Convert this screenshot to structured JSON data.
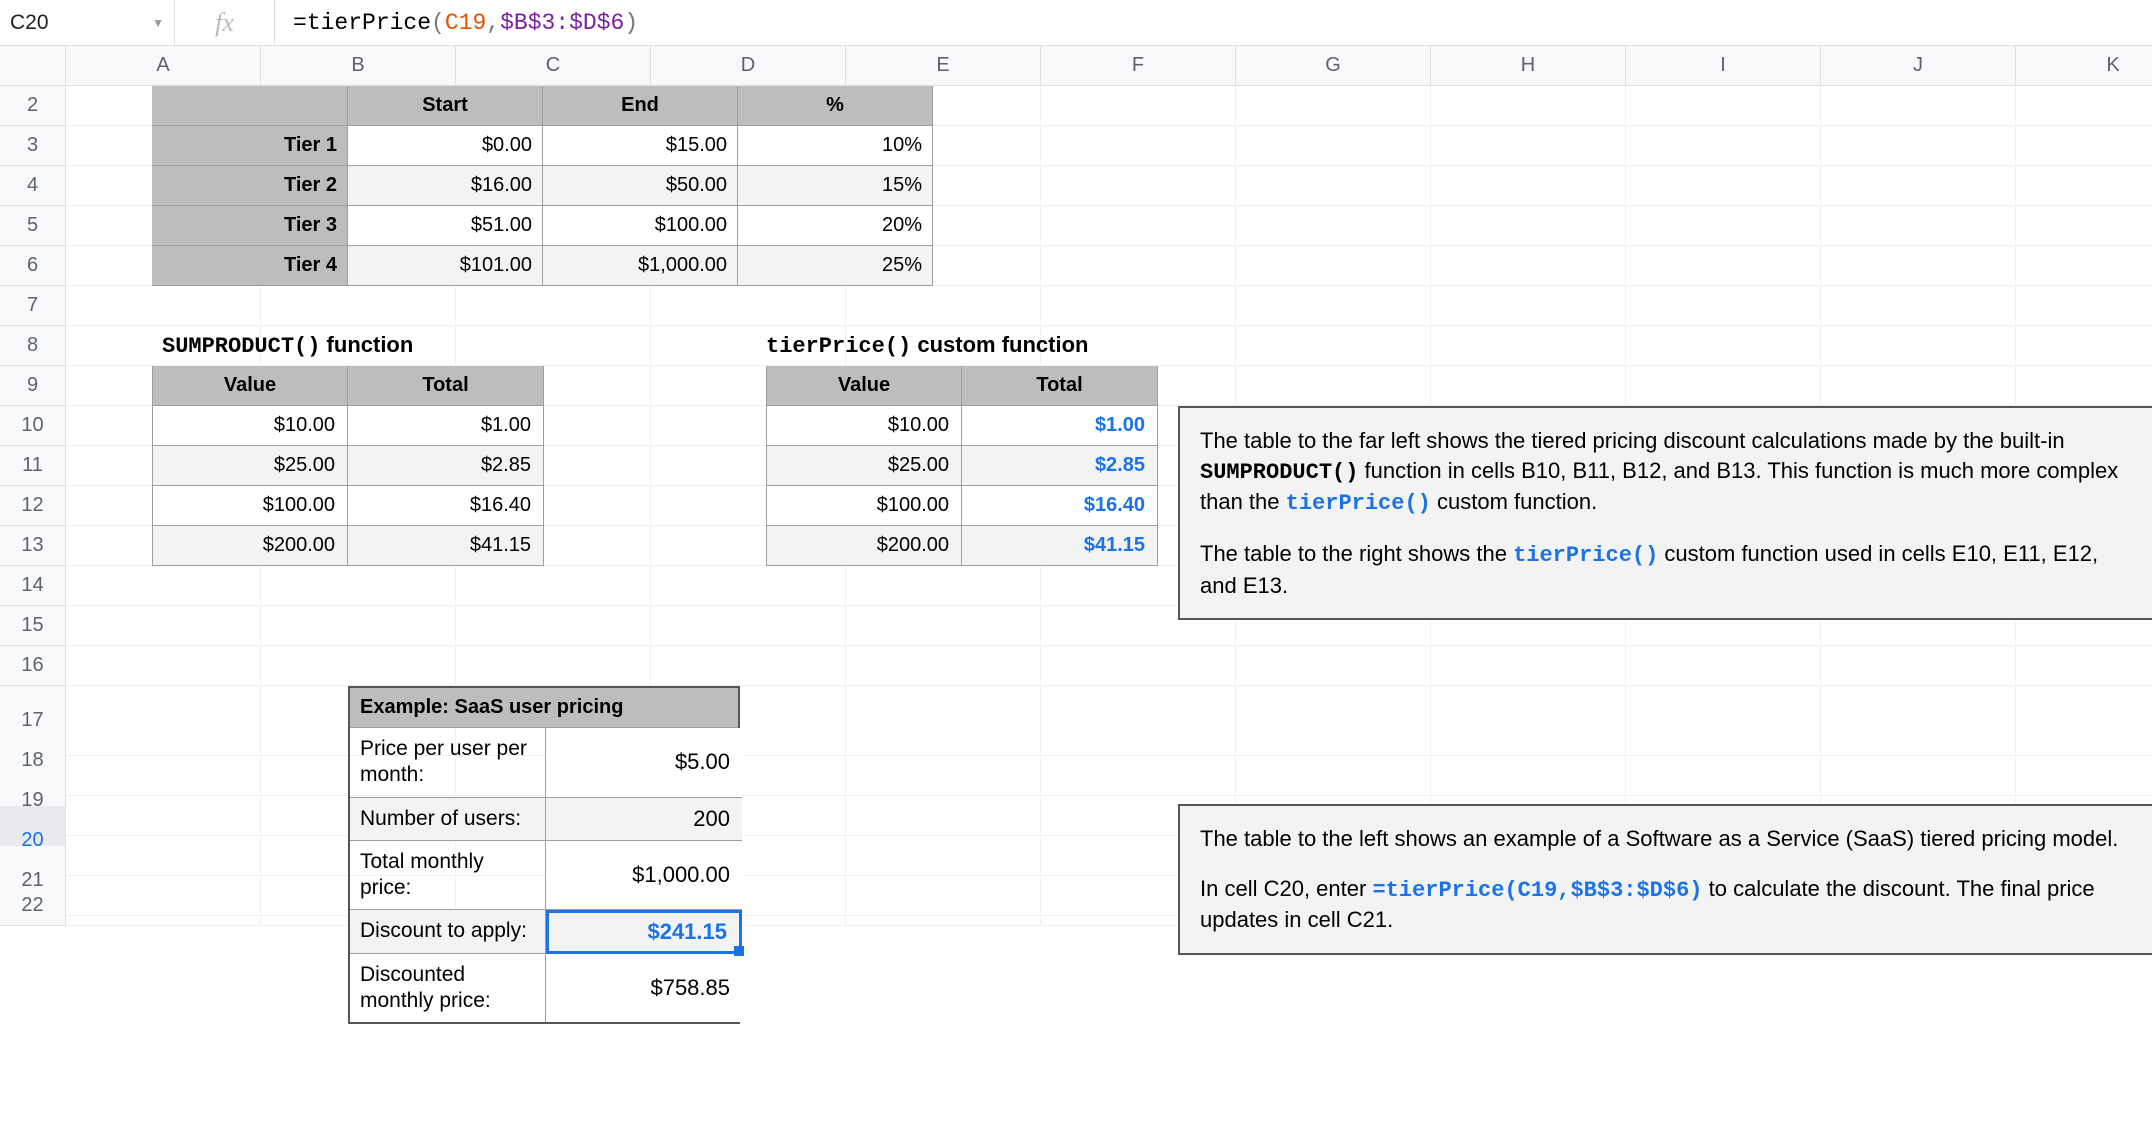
{
  "formula_bar": {
    "cell_ref": "C20",
    "formula_eq": "=",
    "formula_fn": "tierPrice",
    "formula_lp": "(",
    "formula_arg1": "C19",
    "formula_comma": ",",
    "formula_arg2": "$B$3:$D$6",
    "formula_rp": ")"
  },
  "columns": [
    "A",
    "B",
    "C",
    "D",
    "E",
    "F",
    "G",
    "H",
    "I",
    "J",
    "K"
  ],
  "rows": [
    "2",
    "3",
    "4",
    "5",
    "6",
    "7",
    "8",
    "9",
    "10",
    "11",
    "12",
    "13",
    "14",
    "15",
    "16",
    "17",
    "18",
    "19",
    "20",
    "21",
    "22"
  ],
  "selected_row": "20",
  "tiers": {
    "headers": [
      "Start",
      "End",
      "%"
    ],
    "rows": [
      {
        "label": "Tier 1",
        "start": "$0.00",
        "end": "$15.00",
        "pct": "10%"
      },
      {
        "label": "Tier 2",
        "start": "$16.00",
        "end": "$50.00",
        "pct": "15%"
      },
      {
        "label": "Tier 3",
        "start": "$51.00",
        "end": "$100.00",
        "pct": "20%"
      },
      {
        "label": "Tier 4",
        "start": "$101.00",
        "end": "$1,000.00",
        "pct": "25%"
      }
    ]
  },
  "sumproduct_title_mono": "SUMPRODUCT()",
  "sumproduct_title_rest": " function",
  "tierprice_title_mono": "tierPrice()",
  "tierprice_title_rest": " custom function",
  "small_headers": [
    "Value",
    "Total"
  ],
  "sumproduct_table": [
    {
      "value": "$10.00",
      "total": "$1.00"
    },
    {
      "value": "$25.00",
      "total": "$2.85"
    },
    {
      "value": "$100.00",
      "total": "$16.40"
    },
    {
      "value": "$200.00",
      "total": "$41.15"
    }
  ],
  "tier_table": [
    {
      "value": "$10.00",
      "total": "$1.00"
    },
    {
      "value": "$25.00",
      "total": "$2.85"
    },
    {
      "value": "$100.00",
      "total": "$16.40"
    },
    {
      "value": "$200.00",
      "total": "$41.15"
    }
  ],
  "saas": {
    "title": "Example: SaaS user pricing",
    "rows": [
      {
        "label": "Price per user per month:",
        "value": "$5.00"
      },
      {
        "label": "Number of users:",
        "value": "200"
      },
      {
        "label": "Total monthly price:",
        "value": "$1,000.00"
      },
      {
        "label": "Discount to apply:",
        "value": "$241.15"
      },
      {
        "label": "Discounted monthly price:",
        "value": "$758.85"
      }
    ]
  },
  "note1": {
    "p1a": "The table to the far left shows the tiered pricing discount calculations made by the built-in ",
    "p1b": "SUMPRODUCT()",
    "p1c": " function in cells B10, B11, B12, and B13. This function is much more complex than the ",
    "p1d": "tierPrice()",
    "p1e": " custom function.",
    "p2a": "The table to the right shows the ",
    "p2b": "tierPrice()",
    "p2c": " custom function used in cells E10, E11, E12, and E13."
  },
  "note2": {
    "p1": "The table to the left shows an example of a Software as a Service (SaaS) tiered pricing model.",
    "p2a": "In cell C20, enter ",
    "p2b": "=tierPrice(C19,$B$3:$D$6)",
    "p2c": " to calculate the discount. The final price updates in cell C21."
  }
}
